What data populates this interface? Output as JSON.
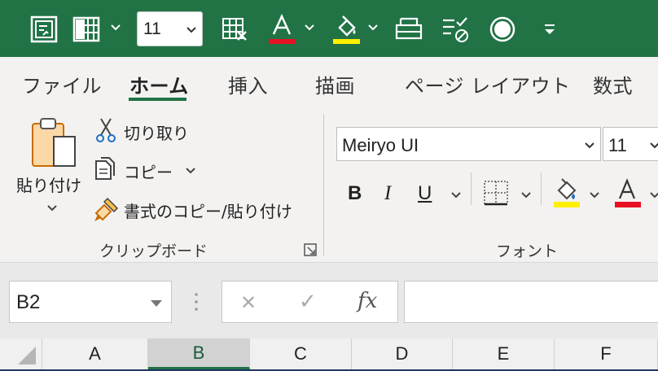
{
  "quick_access": {
    "font_size_value": "11",
    "font_color_swatch": "#e81123",
    "fill_color_swatch": "#ffef00",
    "icons": [
      "form-icon",
      "freeze-panes-icon",
      "font-size-dropdown",
      "clear-borders-icon",
      "font-color-icon",
      "fill-color-icon",
      "print-preview-icon",
      "spelling-clear-icon",
      "record-icon",
      "customize-qat-icon"
    ]
  },
  "tabs": [
    {
      "label": "ファイル",
      "active": false
    },
    {
      "label": "ホーム",
      "active": true
    },
    {
      "label": "挿入",
      "active": false
    },
    {
      "label": "描画",
      "active": false
    },
    {
      "label": "ページ レイアウト",
      "active": false
    },
    {
      "label": "数式",
      "active": false
    }
  ],
  "clipboard": {
    "paste_label": "貼り付け",
    "cut_label": "切り取り",
    "copy_label": "コピー",
    "format_painter_label": "書式のコピー/貼り付け",
    "group_label": "クリップボード"
  },
  "font": {
    "name": "Meiryo UI",
    "size": "11",
    "bold": "B",
    "italic": "I",
    "underline": "U",
    "font_color_letter": "A",
    "group_label": "フォント",
    "highlight_color": "#ffef00",
    "font_color": "#e81123"
  },
  "formula_bar": {
    "name_box": "B2",
    "cancel_glyph": "✕",
    "enter_glyph": "✓",
    "fx_label": "fx",
    "formula": ""
  },
  "columns": [
    "A",
    "B",
    "C",
    "D",
    "E",
    "F"
  ],
  "selected_column": "B",
  "accent_color": "#217346"
}
